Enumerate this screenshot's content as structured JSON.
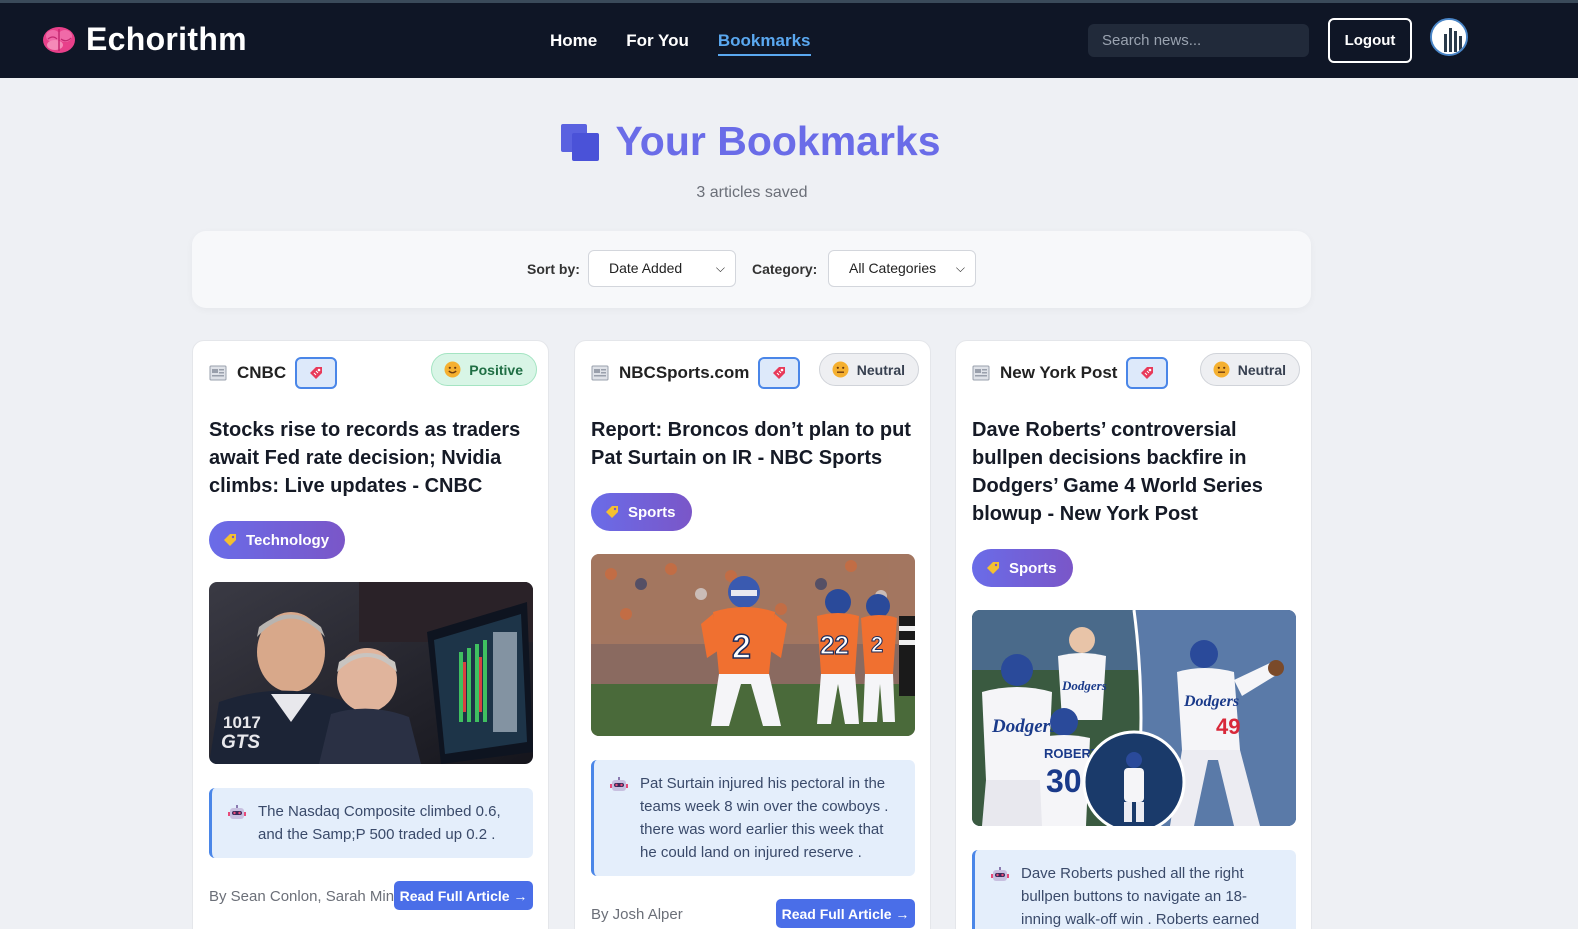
{
  "nav": {
    "brand": "Echorithm",
    "links": [
      {
        "label": "Home",
        "active": false
      },
      {
        "label": "For You",
        "active": false
      },
      {
        "label": "Bookmarks",
        "active": true
      }
    ],
    "search_placeholder": "Search news...",
    "logout_label": "Logout"
  },
  "header": {
    "title": "Your Bookmarks",
    "count_text": "3 articles saved"
  },
  "filters": {
    "sort_label": "Sort by:",
    "sort_value": "Date Added",
    "category_label": "Category:",
    "category_value": "All Categories"
  },
  "articles": [
    {
      "source": "CNBC",
      "sentiment": "Positive",
      "title": "Stocks rise to records as traders await Fed rate decision; Nvidia climbs: Live updates - CNBC",
      "category": "Technology",
      "summary": "The Nasdaq Composite climbed 0.6, and the Samp;P 500 traded up 0.2 .",
      "author": "By Sean Conlon, Sarah Min",
      "read_label": "Read Full Article →"
    },
    {
      "source": "NBCSports.com",
      "sentiment": "Neutral",
      "title": "Report: Broncos don’t plan to put Pat Surtain on IR - NBC Sports",
      "category": "Sports",
      "summary": "Pat Surtain injured his pectoral in the teams week 8 win over the cowboys . there was word earlier this week that he could land on injured reserve .",
      "author": "By Josh Alper",
      "read_label": "Read Full Article →"
    },
    {
      "source": "New York Post",
      "sentiment": "Neutral",
      "title": "Dave Roberts’ controversial bullpen decisions backfire in Dodgers’ Game 4 World Series blowup - New York Post",
      "category": "Sports",
      "summary": "Dave Roberts pushed all the right bullpen buttons to navigate an 18-inning walk-off win . Roberts earned",
      "author": "",
      "read_label": ""
    }
  ],
  "photo_labels": {
    "trader_jacket_text": "1017 GTS",
    "jersey_numbers": [
      "2",
      "22",
      "2"
    ],
    "dodgers_text": [
      "Dodgers",
      "Dodgers",
      "Dodgers",
      "ROBERTS",
      "30",
      "49"
    ]
  },
  "colors": {
    "nav_bg": "#0f1626",
    "accent_title": "#6a6ce8",
    "active_link": "#5aa8f0",
    "read_button": "#4a6ee8",
    "bookmark_border": "#4a86e8"
  },
  "icons": {
    "brand": "brain-icon",
    "title": "bookmark-stack-icon",
    "source": "newspaper-icon",
    "bookmark": "bookmark-tag-icon",
    "positive": "smile-emoji-icon",
    "neutral": "neutral-emoji-icon",
    "category": "tag-icon",
    "summary": "robot-icon"
  }
}
